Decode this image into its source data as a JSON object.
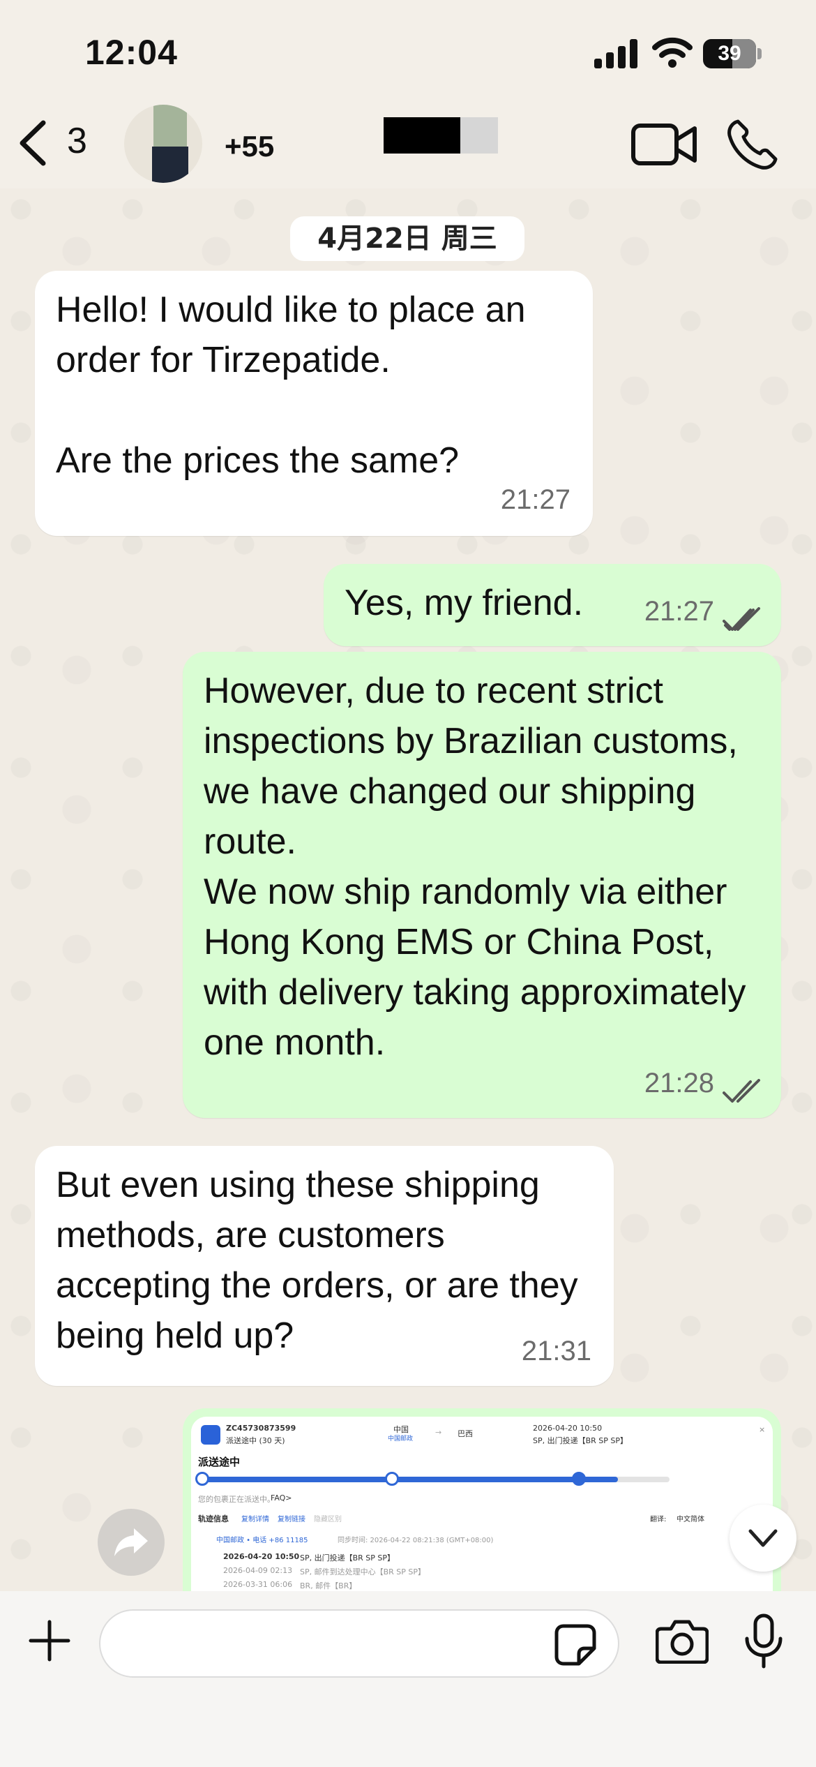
{
  "status_bar": {
    "time": "12:04",
    "battery": "39",
    "icons": [
      "signal-icon",
      "wifi-icon",
      "battery-icon"
    ]
  },
  "header": {
    "back_count": "3",
    "contact_name": "+55",
    "icons": [
      "back-chevron-icon",
      "video-call-icon",
      "phone-call-icon"
    ]
  },
  "chat": {
    "date": "4月22日 周三",
    "messages": [
      {
        "direction": "in",
        "text": "Hello! I would like to place an order for Tirzepatide.\n\nAre the prices the same?",
        "time": "21:27"
      },
      {
        "direction": "out",
        "text": "Yes, my friend.",
        "time": "21:27",
        "status": "read"
      },
      {
        "direction": "out",
        "text": "However, due to recent strict inspections by Brazilian customs, we have changed our shipping route.\nWe now ship randomly via either Hong Kong EMS or China Post, with delivery taking approximately one month.",
        "time": "21:28",
        "status": "read"
      },
      {
        "direction": "in",
        "text": "But even using these shipping methods, are customers accepting the orders, or are they being held up?",
        "time": "21:31"
      }
    ],
    "image_message": {
      "tracking_number": "ZC45730873599",
      "in_transit_days": "派送途中 (30 天)",
      "origin": "中国",
      "origin_sub": "中国邮政",
      "destination": "巴西",
      "latest_time": "2026-04-20 10:50",
      "latest_place": "SP, 出门投递【BR SP SP】",
      "status_title": "派送途中",
      "notice": "您的包裹正在派送中。",
      "faq": "FAQ>",
      "tabs": [
        "轨迹信息",
        "复制详情",
        "复制链接",
        "隐藏区别"
      ],
      "translate_label": "翻译:",
      "translate_value": "中文简体",
      "carrier_line": "中国邮政 • 电话 +86 11185",
      "sync_time": "同步时间: 2026-04-22 08:21:38 (GMT+08:00)",
      "events": [
        {
          "time": "2026-04-20 10:50",
          "desc": "SP, 出门投递【BR SP SP】"
        },
        {
          "time": "2026-04-09 02:13",
          "desc": "SP, 邮件到达处理中心【BR SP SP】"
        },
        {
          "time": "2026-03-31 06:06",
          "desc": "BR, 邮件【BR】"
        }
      ],
      "progress": 0.89
    }
  },
  "input_bar": {
    "placeholder": "",
    "icons": [
      "plus-icon",
      "sticker-icon",
      "camera-icon",
      "microphone-icon"
    ]
  }
}
